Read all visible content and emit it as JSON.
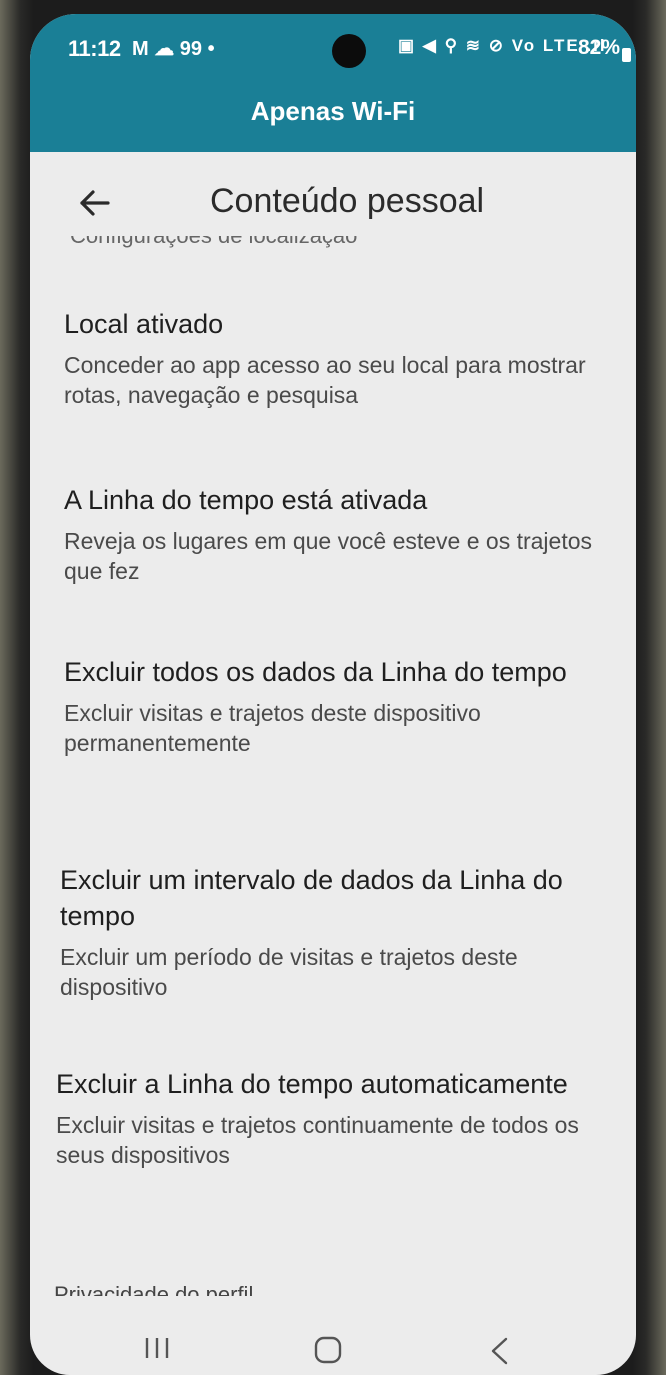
{
  "status_bar": {
    "time": "11:12",
    "notifications": "M ☁ 99 •",
    "icons": "▣ ◀ ⚲ ≋ ⊘ Vo LTE .ıl",
    "battery": "82%"
  },
  "network_label": "Apenas Wi-Fi",
  "app_bar": {
    "title": "Conteúdo pessoal",
    "back_icon": "arrow-left-icon"
  },
  "settings": [
    {
      "title": "Local ativado",
      "description": "Conceder ao app acesso ao seu local para mostrar rotas, navegação e pesquisa"
    },
    {
      "title": "A Linha do tempo está ativada",
      "description": "Reveja os lugares em que você esteve e os trajetos que fez"
    },
    {
      "title": "Excluir todos os dados da Linha do tempo",
      "description": "Excluir visitas e trajetos deste dispositivo permanentemente"
    },
    {
      "title": "Excluir um intervalo de dados da Linha do tempo",
      "description": "Excluir um período de visitas e trajetos deste dispositivo"
    },
    {
      "title": "Excluir a Linha do tempo automaticamente",
      "description": "Excluir visitas e trajetos continuamente de todos os seus dispositivos"
    }
  ],
  "cut_off": {
    "top": "Configurações de localização",
    "bottom": "Privacidade do perfil"
  },
  "nav_bar": {
    "recents_icon": "recents-icon",
    "home_icon": "home-icon",
    "back_icon": "nav-back-icon"
  },
  "colors": {
    "status_background": "#1a7f96",
    "screen_background": "#ececec",
    "title_text": "#1f1f1f",
    "description_text": "#4a4a4a"
  }
}
